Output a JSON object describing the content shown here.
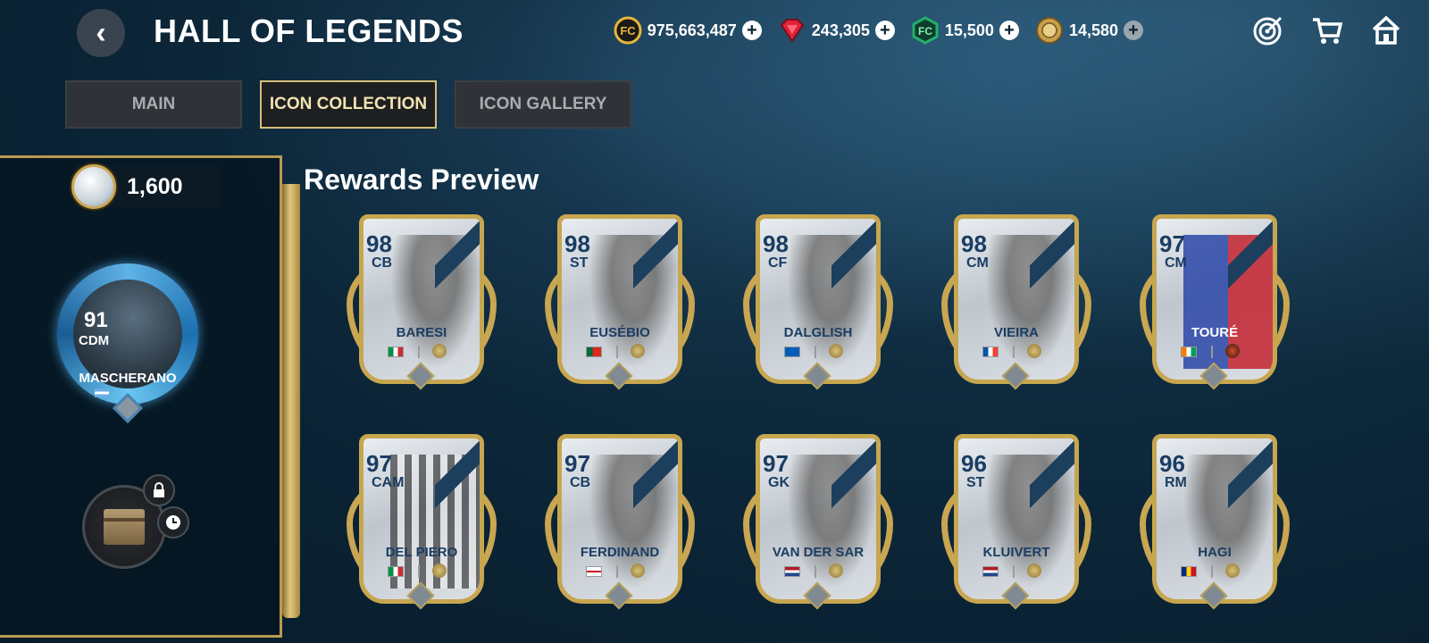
{
  "header": {
    "title": "HALL OF LEGENDS",
    "currencies": [
      {
        "value": "975,663,487",
        "icon": "fc-points-icon",
        "color": "#e8b43a"
      },
      {
        "value": "243,305",
        "icon": "ruby-gem-icon",
        "color": "#e0223a"
      },
      {
        "value": "15,500",
        "icon": "green-gem-icon",
        "color": "#23b06a"
      },
      {
        "value": "14,580",
        "icon": "gold-coin-icon",
        "color": "#c9a04a"
      }
    ]
  },
  "tabs": [
    {
      "label": "MAIN"
    },
    {
      "label": "ICON COLLECTION"
    },
    {
      "label": "ICON GALLERY"
    }
  ],
  "left_panel": {
    "token_count": "1,600",
    "featured": {
      "rating": "91",
      "position": "CDM",
      "name": "MASCHERANO"
    }
  },
  "rewards": {
    "title": "Rewards Preview",
    "cards": [
      {
        "rating": "98",
        "position": "CB",
        "name": "BARESI",
        "flag": "italy"
      },
      {
        "rating": "98",
        "position": "ST",
        "name": "EUSÉBIO",
        "flag": "portugal"
      },
      {
        "rating": "98",
        "position": "CF",
        "name": "DALGLISH",
        "flag": "scotland"
      },
      {
        "rating": "98",
        "position": "CM",
        "name": "VIEIRA",
        "flag": "france"
      },
      {
        "rating": "97",
        "position": "CM",
        "name": "TOURÉ",
        "flag": "ivory-coast"
      },
      {
        "rating": "97",
        "position": "CAM",
        "name": "DEL PIERO",
        "flag": "italy"
      },
      {
        "rating": "97",
        "position": "CB",
        "name": "FERDINAND",
        "flag": "england"
      },
      {
        "rating": "97",
        "position": "GK",
        "name": "VAN DER SAR",
        "flag": "netherlands"
      },
      {
        "rating": "96",
        "position": "ST",
        "name": "KLUIVERT",
        "flag": "netherlands"
      },
      {
        "rating": "96",
        "position": "RM",
        "name": "HAGI",
        "flag": "romania"
      }
    ]
  }
}
